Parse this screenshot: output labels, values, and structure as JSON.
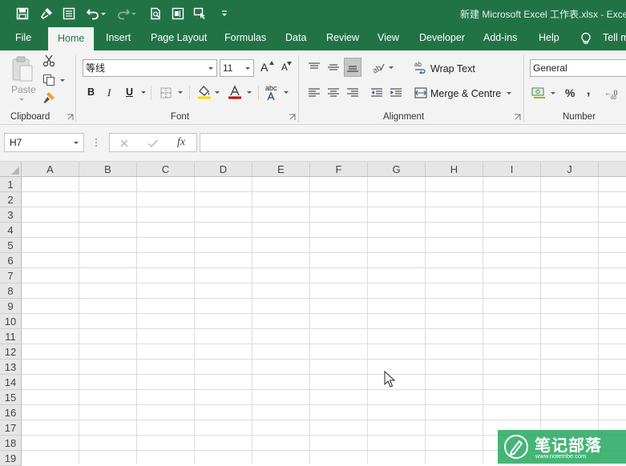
{
  "window": {
    "title": "新建 Microsoft Excel 工作表.xlsx  -  Exce"
  },
  "quick_access": [
    "save-icon",
    "format-painter-icon",
    "form-icon",
    "undo-icon",
    "redo-icon",
    "print-preview-icon",
    "screenshot-icon",
    "touch-mode-icon",
    "customize-qat-icon"
  ],
  "tabs": [
    "File",
    "Home",
    "Insert",
    "Page Layout",
    "Formulas",
    "Data",
    "Review",
    "View",
    "Developer",
    "Add-ins",
    "Help",
    "Tell m"
  ],
  "active_tab": "Home",
  "ribbon": {
    "clipboard": {
      "label": "Clipboard",
      "paste_label": "Paste"
    },
    "font": {
      "label": "Font",
      "font_name": "等线",
      "font_size": "11",
      "bold": "B",
      "italic": "I",
      "underline": "U",
      "grow": "A",
      "shrink": "A",
      "phonetic": "abc",
      "font_color": "#c00000",
      "fill_color": "#ffd400"
    },
    "alignment": {
      "label": "Alignment",
      "wrap_text": "Wrap Text",
      "merge_centre": "Merge & Centre"
    },
    "number": {
      "label": "Number",
      "format": "General",
      "percent": "%",
      "comma": ","
    }
  },
  "formula_bar": {
    "name_box": "H7",
    "fx": "fx",
    "formula": ""
  },
  "sheet": {
    "columns": [
      "A",
      "B",
      "C",
      "D",
      "E",
      "F",
      "G",
      "H",
      "I",
      "J"
    ],
    "rows": [
      "1",
      "2",
      "3",
      "4",
      "5",
      "6",
      "7",
      "8",
      "9",
      "10",
      "11",
      "12",
      "13",
      "14",
      "15",
      "16",
      "17",
      "18",
      "19"
    ]
  },
  "watermark": {
    "title": "笔记部落",
    "subtitle": "www.notetribe.com"
  },
  "colors": {
    "brand": "#217346",
    "ribbon_bg": "#f3f3f3",
    "header_bg": "#e6e6e6",
    "grid": "#dcdcdc"
  }
}
